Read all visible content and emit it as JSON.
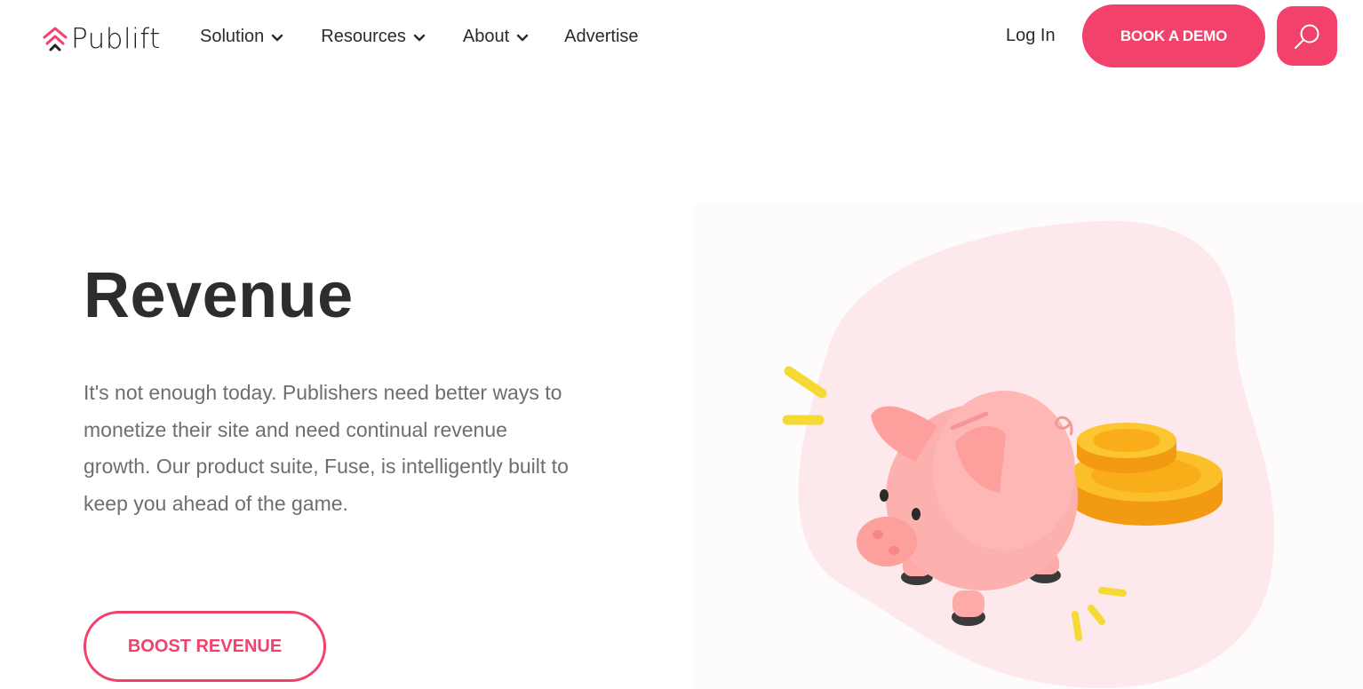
{
  "brand": {
    "name": "Publift",
    "accent": "#f2416b"
  },
  "nav": {
    "items": [
      {
        "label": "Solution",
        "has_dropdown": true
      },
      {
        "label": "Resources",
        "has_dropdown": true
      },
      {
        "label": "About",
        "has_dropdown": true
      },
      {
        "label": "Advertise",
        "has_dropdown": false
      }
    ],
    "login_label": "Log In",
    "demo_label": "BOOK A DEMO",
    "search_icon": "search-icon"
  },
  "hero": {
    "title": "Revenue",
    "lines": [
      "It's not enough today. Publishers need better ways to",
      "monetize their site and need continual revenue",
      "growth. Our product suite, Fuse, is intelligently built to",
      "keep you ahead of the game."
    ],
    "cta_label": "BOOST REVENUE",
    "illustration": "piggy-bank-with-coins-illustration"
  }
}
